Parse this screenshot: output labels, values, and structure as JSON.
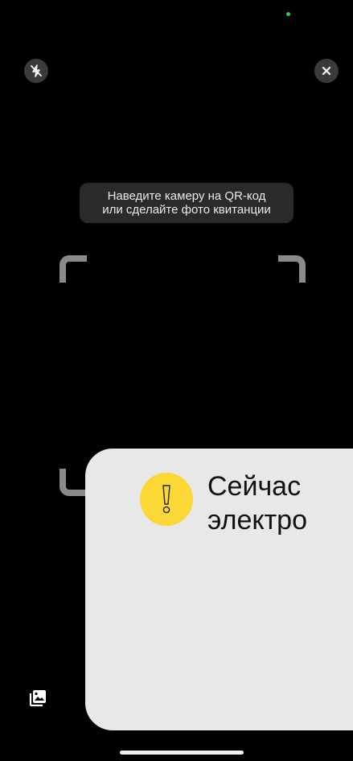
{
  "status": {
    "camera_indicator_color": "#34c759"
  },
  "toolbar": {
    "flash_icon": "flash-off-icon",
    "close_icon": "close-icon",
    "gallery_icon": "gallery-icon"
  },
  "scanner": {
    "hint_line1": "Наведите камеру на QR-код",
    "hint_line2": "или сделайте фото квитанции"
  },
  "alert": {
    "icon": "warning-icon",
    "accent_color": "#fcd836",
    "text_line1": "Сейчас",
    "text_line2": "электро"
  }
}
